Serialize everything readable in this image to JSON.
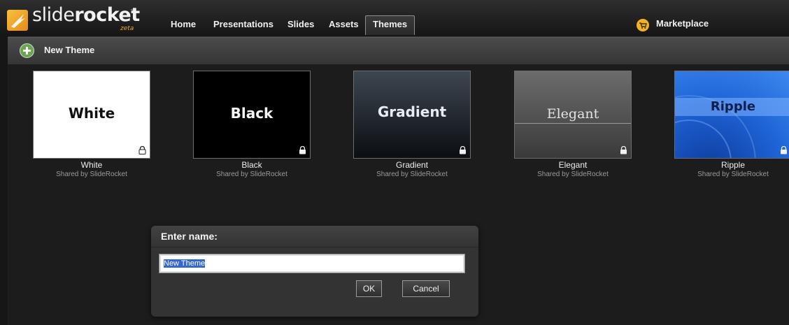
{
  "brand": {
    "name_light": "slide",
    "name_bold": "rocket",
    "tm": "™",
    "edition": "zeta"
  },
  "nav": {
    "tabs": [
      {
        "label": "Home"
      },
      {
        "label": "Presentations"
      },
      {
        "label": "Slides"
      },
      {
        "label": "Assets"
      },
      {
        "label": "Themes",
        "active": true
      }
    ],
    "marketplace_label": "Marketplace"
  },
  "toolbar": {
    "new_theme_label": "New Theme"
  },
  "themes": [
    {
      "title": "White",
      "name": "White",
      "shared_by": "Shared by SlideRocket",
      "locked": true
    },
    {
      "title": "Black",
      "name": "Black",
      "shared_by": "Shared by SlideRocket",
      "locked": true
    },
    {
      "title": "Gradient",
      "name": "Gradient",
      "shared_by": "Shared by SlideRocket",
      "locked": true
    },
    {
      "title": "Elegant",
      "name": "Elegant",
      "shared_by": "Shared by SlideRocket",
      "locked": true
    },
    {
      "title": "Ripple",
      "name": "Ripple",
      "shared_by": "Shared by SlideRocket",
      "locked": true
    }
  ],
  "dialog": {
    "title": "Enter name:",
    "input_value": "New Theme",
    "ok_label": "OK",
    "cancel_label": "Cancel"
  },
  "colors": {
    "brand_accent": "#f2a51c",
    "plus_green": "#6aa84f",
    "ripple_blue": "#1e63d6"
  },
  "icons": {
    "logo": "rocket-logo-icon",
    "marketplace": "shopping-cart-icon",
    "new_theme": "plus-circle-icon",
    "lock": "lock-icon"
  }
}
